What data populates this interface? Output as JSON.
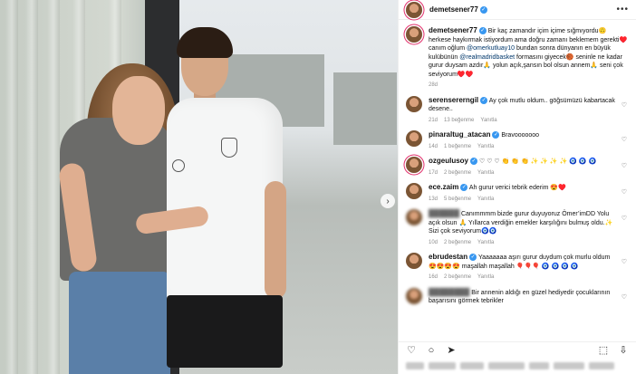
{
  "post": {
    "author": "demetsener77",
    "more": "•••",
    "carousel_next": "›"
  },
  "caption": {
    "username": "demetsener77",
    "text_1": "Bir kaç zamandır içim içime sığmıyordu🙃 herkese haykırmak istiyordum ama doğru zamanı beklemem gerekti♥️ canım oğlum ",
    "mention_1": "@omerkutluay10",
    "text_2": " bundan sonra dünyanın en büyük kulübünün ",
    "mention_2": "@realmadridbasket",
    "text_3": " formasını giyecek🏀 seninle ne kadar gurur duysam azdır🙏 yolun açık,şansın bol olsun annem🙏 seni çok seviyorum♥️♥️",
    "time": "28d"
  },
  "comments": [
    {
      "user": "serensererngil",
      "verified": true,
      "text": "Ay çok mutlu oldum.. göğsümüzü kabartacak desene..",
      "time": "21d",
      "likes": "13 beğenme",
      "reply": "Yanıtla"
    },
    {
      "user": "pinaraltug_atacan",
      "verified": true,
      "text": "Bravooooooo",
      "time": "14d",
      "likes": "1 beğenme",
      "reply": "Yanıtla"
    },
    {
      "user": "ozgeulusoy",
      "verified": true,
      "text": "♡ ♡ ♡ 👏 👏 👏 ✨ ✨ ✨ ✨ 🧿 🧿 🧿",
      "time": "17d",
      "likes": "2 beğenme",
      "reply": "Yanıtla"
    },
    {
      "user": "ece.zaim",
      "verified": true,
      "text": "Ah gurur verici tebrik ederim 😍♥️",
      "time": "13d",
      "likes": "5 beğenme",
      "reply": "Yanıtla"
    },
    {
      "user": "",
      "verified": false,
      "text": "Canımmmm bizde gurur duyuyoruz Ömer’imDD Yolu açık olsun 🙏 Yıllarca verdiğin emekler karşılığını bulmuş oldu.✨ Sizi çok seviyorum🧿🧿",
      "time": "10d",
      "likes": "2 beğenme",
      "reply": "Yanıtla"
    },
    {
      "user": "ebrudestan",
      "verified": true,
      "text": "Yaaaaaaa aşırı gurur duydum çok murlu oldum 😍😍😍😍 maşallah maşallah 🎈🎈🎈 🧿 🧿 🧿 🧿",
      "time": "16d",
      "likes": "2 beğenme",
      "reply": "Yanıtla"
    },
    {
      "user": "",
      "verified": false,
      "text": "Bir annenin aldığı en güzel hediyedir çocuklarının başarısını görmek tebrikler",
      "time": "",
      "likes": "",
      "reply": ""
    }
  ],
  "icons": {
    "heart": "♡",
    "comment": "○",
    "share": "➤",
    "save": "⬚",
    "upload": "⇩"
  },
  "colors": {
    "link": "#00376b",
    "verified": "#3897f0",
    "meta": "#8e8e8e"
  }
}
